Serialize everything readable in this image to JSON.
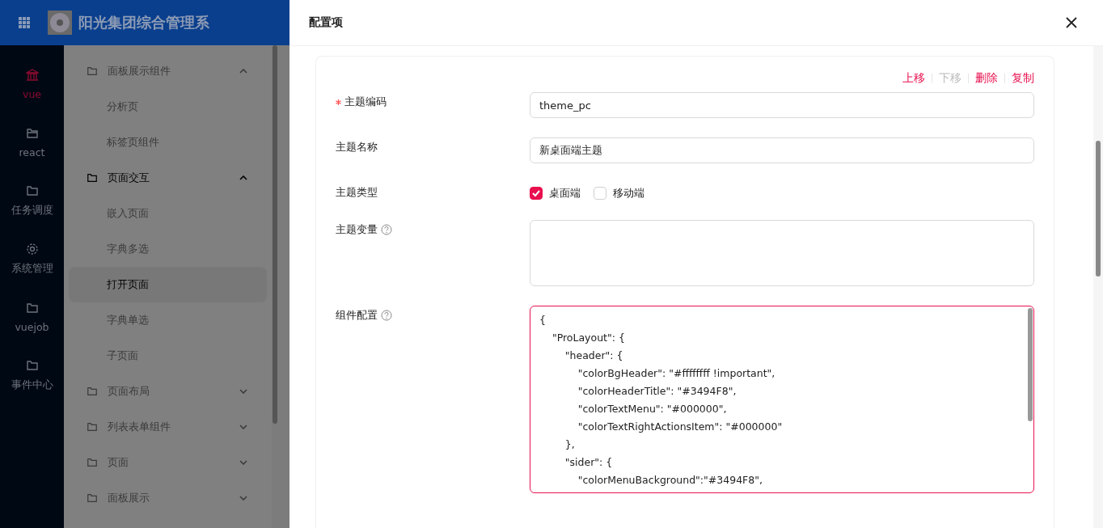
{
  "header": {
    "title": "阳光集团综合管理系"
  },
  "rail": [
    {
      "label": "vue",
      "kind": "bank",
      "selected": true
    },
    {
      "label": "react",
      "kind": "folder-open",
      "selected": false
    },
    {
      "label": "任务调度",
      "kind": "folder",
      "selected": false
    },
    {
      "label": "系统管理",
      "kind": "gear",
      "selected": false
    },
    {
      "label": "vuejob",
      "kind": "folder",
      "selected": false
    },
    {
      "label": "事件中心",
      "kind": "folder",
      "selected": false
    }
  ],
  "submenu": [
    {
      "label": "面板展示组件",
      "expanded": true,
      "selected": false,
      "children": [
        {
          "label": "分析页",
          "selected": false
        },
        {
          "label": "标签页组件",
          "selected": false
        }
      ]
    },
    {
      "label": "页面交互",
      "expanded": true,
      "selected": true,
      "children": [
        {
          "label": "嵌入页面",
          "selected": false
        },
        {
          "label": "字典多选",
          "selected": false
        },
        {
          "label": "打开页面",
          "selected": true
        },
        {
          "label": "字典单选",
          "selected": false
        },
        {
          "label": "子页面",
          "selected": false
        }
      ]
    },
    {
      "label": "页面布局",
      "expanded": false,
      "selected": false
    },
    {
      "label": "列表表单组件",
      "expanded": false,
      "selected": false
    },
    {
      "label": "页面",
      "expanded": false,
      "selected": false
    },
    {
      "label": "面板展示",
      "expanded": false,
      "selected": false
    }
  ],
  "drawer": {
    "title": "配置项",
    "actions": [
      {
        "label": "上移",
        "disabled": false
      },
      {
        "label": "下移",
        "disabled": true
      },
      {
        "label": "删除",
        "disabled": false
      },
      {
        "label": "复制",
        "disabled": false
      }
    ],
    "fields": [
      {
        "kind": "input",
        "label": "主题编码",
        "required": true,
        "help": false,
        "value": "theme_pc"
      },
      {
        "kind": "input",
        "label": "主题名称",
        "required": false,
        "help": false,
        "value": "新桌面端主题"
      },
      {
        "kind": "checkboxes",
        "label": "主题类型",
        "required": false,
        "help": false,
        "options": [
          {
            "label": "桌面端",
            "checked": true
          },
          {
            "label": "移动端",
            "checked": false
          }
        ]
      },
      {
        "kind": "textarea",
        "label": "主题变量",
        "required": false,
        "help": true,
        "focused": false
      },
      {
        "kind": "textarea",
        "label": "组件配置",
        "required": false,
        "help": true,
        "focused": true,
        "value": "{\n    \"ProLayout\": {\n        \"header\": {\n            \"colorBgHeader\": \"#ffffffff !important\",\n            \"colorHeaderTitle\": \"#3494F8\",\n            \"colorTextMenu\": \"#000000\",\n            \"colorTextRightActionsItem\": \"#000000\"\n        },\n        \"sider\": {\n            \"colorMenuBackground\":\"#3494F8\","
      }
    ]
  }
}
